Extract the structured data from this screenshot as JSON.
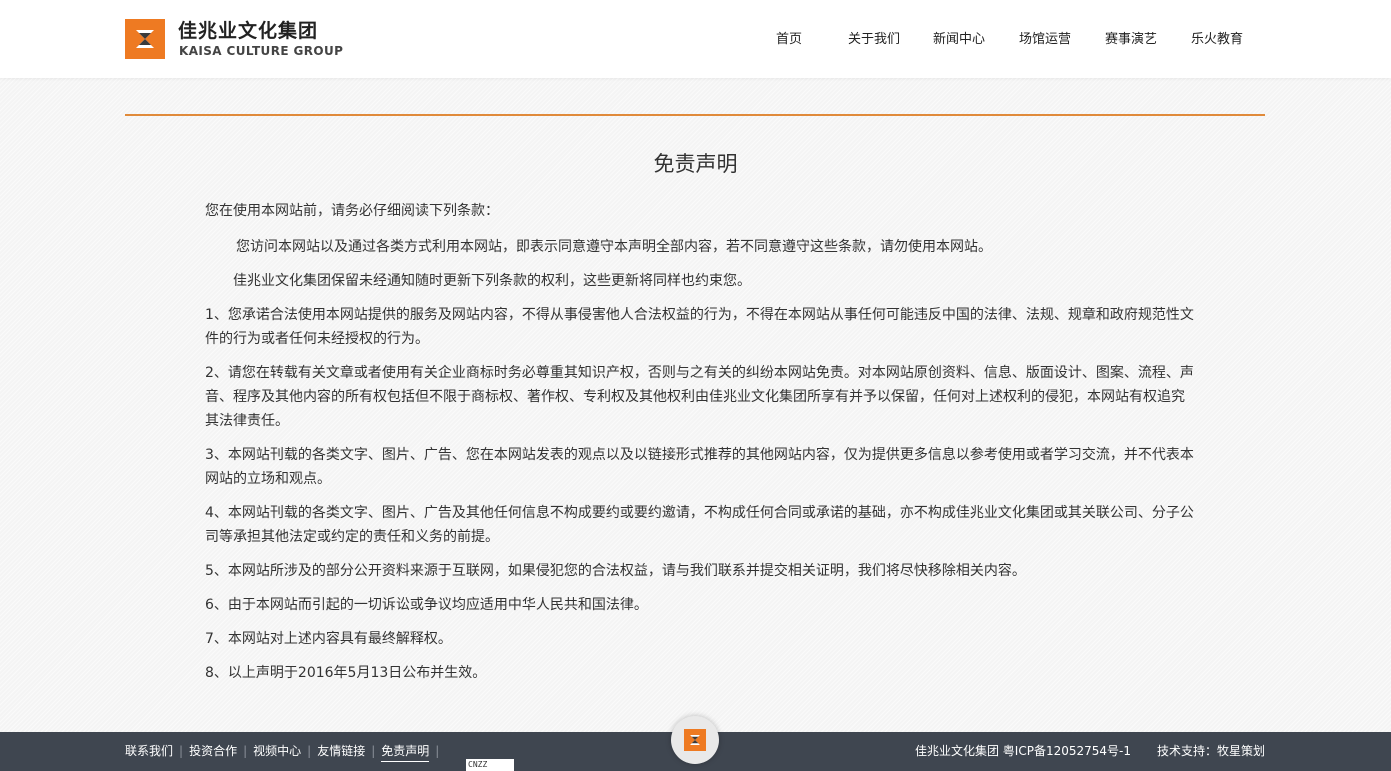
{
  "brand": {
    "name_cn": "佳兆业文化集团",
    "name_en": "KAISA CULTURE GROUP",
    "color": "#ee7a22"
  },
  "nav": {
    "items": [
      {
        "label": "首页"
      },
      {
        "label": "关于我们"
      },
      {
        "label": "新闻中心"
      },
      {
        "label": "场馆运营"
      },
      {
        "label": "赛事演艺"
      },
      {
        "label": "乐火教育"
      }
    ]
  },
  "page": {
    "title": "免责声明",
    "intro": "您在使用本网站前，请务必仔细阅读下列条款：",
    "paragraphs": [
      "您访问本网站以及通过各类方式利用本网站，即表示同意遵守本声明全部内容，若不同意遵守这些条款，请勿使用本网站。",
      "佳兆业文化集团保留未经通知随时更新下列条款的权利，这些更新将同样也约束您。"
    ],
    "clauses": [
      "1、您承诺合法使用本网站提供的服务及网站内容，不得从事侵害他人合法权益的行为，不得在本网站从事任何可能违反中国的法律、法规、规章和政府规范性文件的行为或者任何未经授权的行为。",
      "2、请您在转载有关文章或者使用有关企业商标时务必尊重其知识产权，否则与之有关的纠纷本网站免责。对本网站原创资料、信息、版面设计、图案、流程、声音、程序及其他内容的所有权包括但不限于商标权、著作权、专利权及其他权利由佳兆业文化集团所享有并予以保留，任何对上述权利的侵犯，本网站有权追究其法律责任。",
      "3、本网站刊载的各类文字、图片、广告、您在本网站发表的观点以及以链接形式推荐的其他网站内容，仅为提供更多信息以参考使用或者学习交流，并不代表本网站的立场和观点。",
      "4、本网站刊载的各类文字、图片、广告及其他任何信息不构成要约或要约邀请，不构成任何合同或承诺的基础，亦不构成佳兆业文化集团或其关联公司、分子公司等承担其他法定或约定的责任和义务的前提。",
      "5、本网站所涉及的部分公开资料来源于互联网，如果侵犯您的合法权益，请与我们联系并提交相关证明，我们将尽快移除相关内容。",
      "6、由于本网站而引起的一切诉讼或争议均应适用中华人民共和国法律。",
      "7、本网站对上述内容具有最终解释权。",
      "8、以上声明于2016年5月13日公布并生效。"
    ]
  },
  "footer": {
    "links": [
      {
        "label": "联系我们"
      },
      {
        "label": "投资合作"
      },
      {
        "label": "视频中心"
      },
      {
        "label": "友情链接"
      },
      {
        "label": "免责声明"
      }
    ],
    "separator": "|",
    "badge": "CNZZ",
    "icp": "佳兆业文化集团 粤ICP备12052754号-1",
    "support": "技术支持：牧星策划"
  }
}
